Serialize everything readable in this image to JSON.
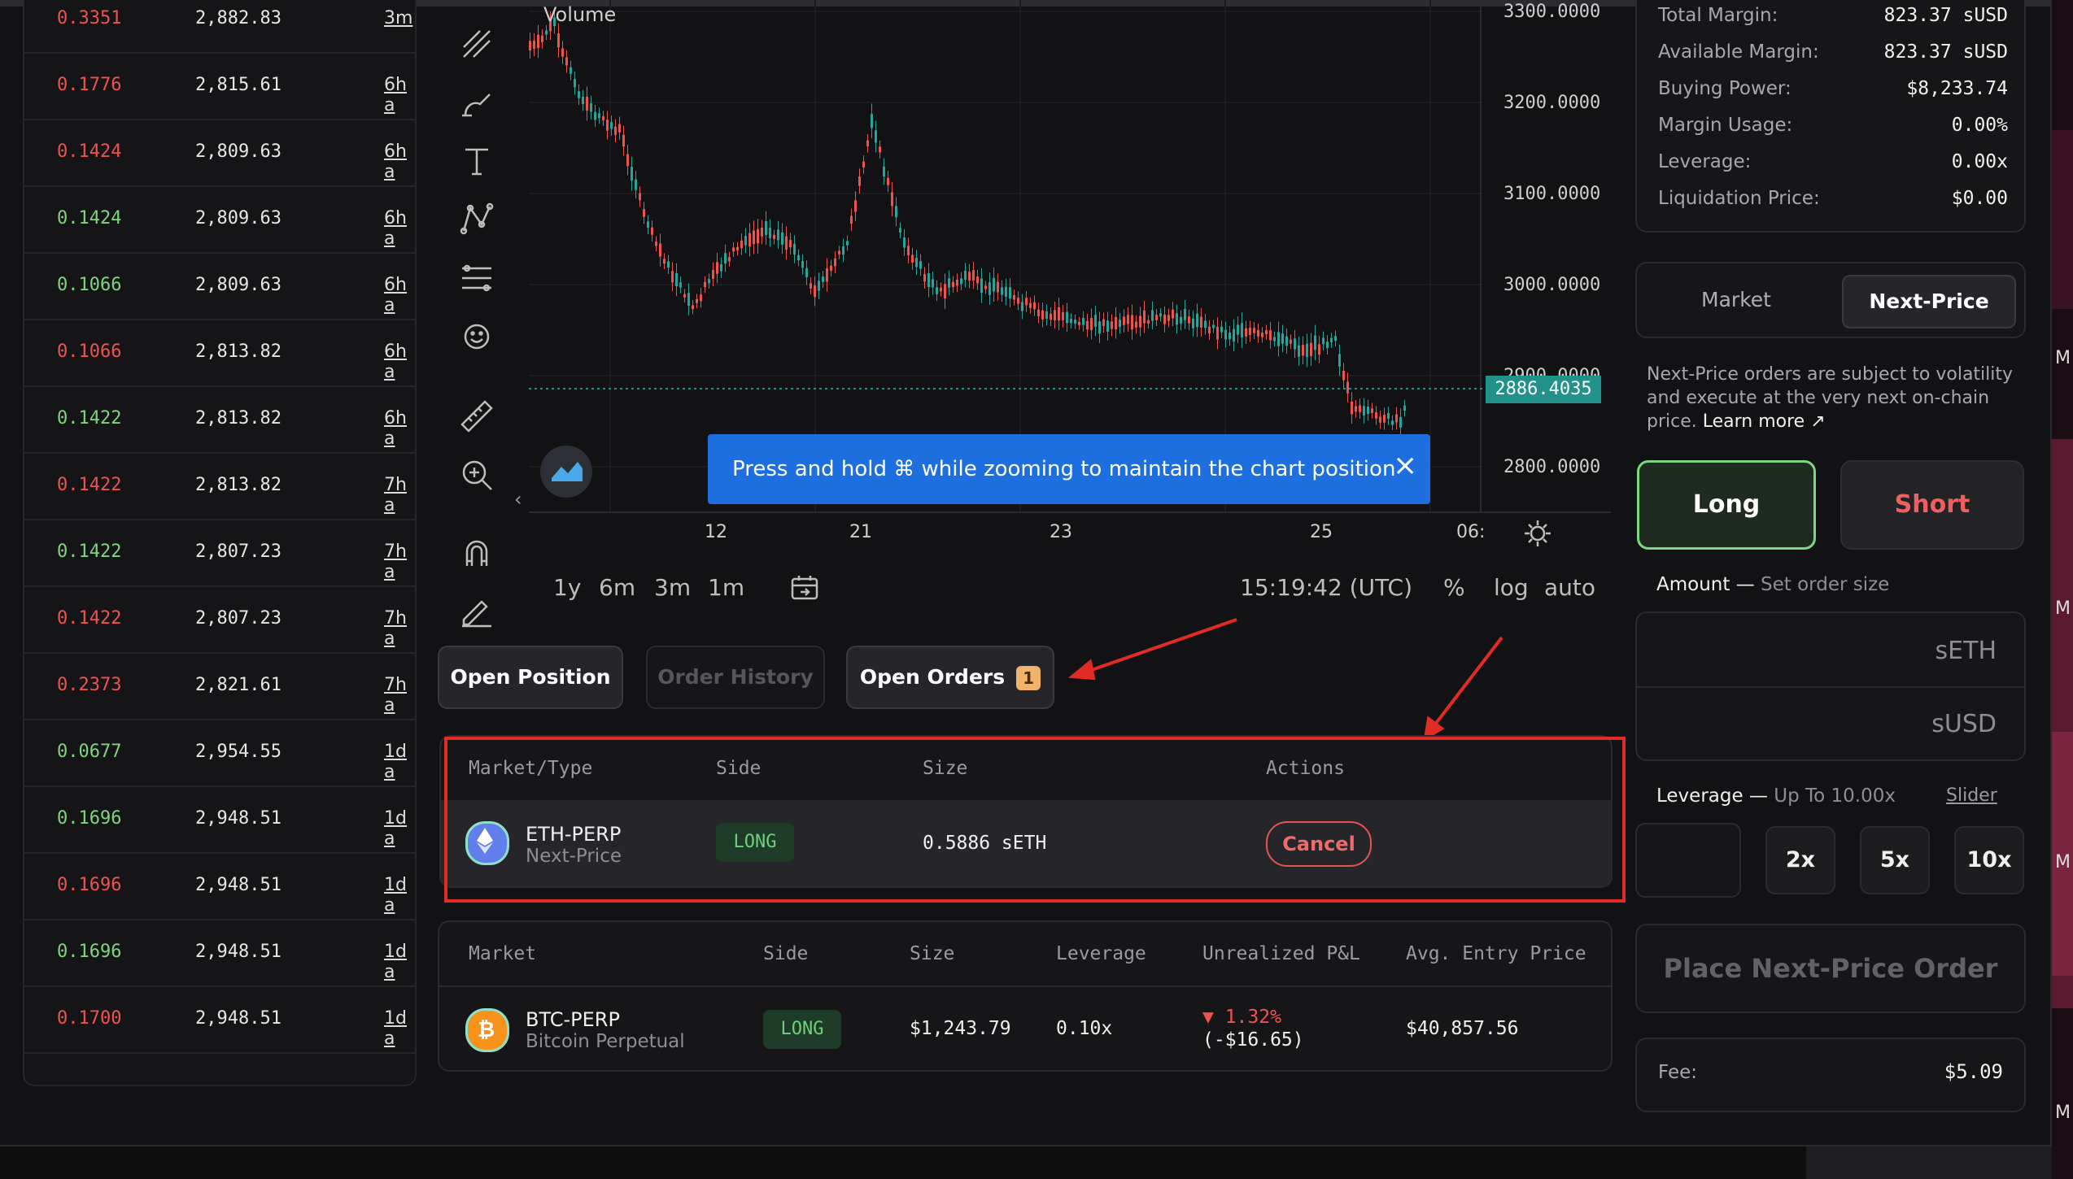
{
  "trades": [
    {
      "price": "0.3351",
      "amount": "2,882.83",
      "time": "3m",
      "color": "red"
    },
    {
      "price": "0.1776",
      "amount": "2,815.61",
      "time": "6h a",
      "color": "red"
    },
    {
      "price": "0.1424",
      "amount": "2,809.63",
      "time": "6h a",
      "color": "red"
    },
    {
      "price": "0.1424",
      "amount": "2,809.63",
      "time": "6h a",
      "color": "green"
    },
    {
      "price": "0.1066",
      "amount": "2,809.63",
      "time": "6h a",
      "color": "green"
    },
    {
      "price": "0.1066",
      "amount": "2,813.82",
      "time": "6h a",
      "color": "red"
    },
    {
      "price": "0.1422",
      "amount": "2,813.82",
      "time": "6h a",
      "color": "green"
    },
    {
      "price": "0.1422",
      "amount": "2,813.82",
      "time": "7h a",
      "color": "red"
    },
    {
      "price": "0.1422",
      "amount": "2,807.23",
      "time": "7h a",
      "color": "green"
    },
    {
      "price": "0.1422",
      "amount": "2,807.23",
      "time": "7h a",
      "color": "red"
    },
    {
      "price": "0.2373",
      "amount": "2,821.61",
      "time": "7h a",
      "color": "red"
    },
    {
      "price": "0.0677",
      "amount": "2,954.55",
      "time": "1d a",
      "color": "green"
    },
    {
      "price": "0.1696",
      "amount": "2,948.51",
      "time": "1d a",
      "color": "green"
    },
    {
      "price": "0.1696",
      "amount": "2,948.51",
      "time": "1d a",
      "color": "red"
    },
    {
      "price": "0.1696",
      "amount": "2,948.51",
      "time": "1d a",
      "color": "green"
    },
    {
      "price": "0.1700",
      "amount": "2,948.51",
      "time": "1d a",
      "color": "red"
    }
  ],
  "chart": {
    "volume_label": "Volume",
    "y_ticks": [
      "3300.0000",
      "3200.0000",
      "3100.0000",
      "3000.0000",
      "2900.0000",
      "2800.0000"
    ],
    "x_ticks": [
      "12",
      "21",
      "23",
      "25",
      "06:"
    ],
    "last_price": "2886.4035",
    "nav_arrow": "‹",
    "toast": {
      "message": "Press and hold ⌘ while zooming to maintain the chart position",
      "close": "×"
    },
    "timeframes": [
      "1y",
      "6m",
      "3m",
      "1m"
    ],
    "clock": "15:19:42 (UTC)",
    "scale_options": [
      "%",
      "log",
      "auto"
    ]
  },
  "tabs": {
    "open_position": "Open Position",
    "order_history": "Order History",
    "open_orders": "Open Orders",
    "open_orders_count": "1"
  },
  "orders": {
    "headers": [
      "Market/Type",
      "Side",
      "Size",
      "Actions"
    ],
    "row": {
      "market": "ETH-PERP",
      "type": "Next-Price",
      "side": "LONG",
      "size": "0.5886 sETH",
      "action": "Cancel"
    }
  },
  "positions": {
    "headers": [
      "Market",
      "Side",
      "Size",
      "Leverage",
      "Unrealized P&L",
      "Avg. Entry Price"
    ],
    "row": {
      "market": "BTC-PERP",
      "subtitle": "Bitcoin Perpetual",
      "side": "LONG",
      "size": "$1,243.79",
      "leverage": "0.10x",
      "pnl_pct": "▼ 1.32%",
      "pnl_usd": "(-$16.65)",
      "entry": "$40,857.56"
    }
  },
  "summary": [
    {
      "label": "Total Margin:",
      "value": "823.37 sUSD"
    },
    {
      "label": "Available Margin:",
      "value": "823.37 sUSD"
    },
    {
      "label": "Buying Power:",
      "value": "$8,233.74"
    },
    {
      "label": "Margin Usage:",
      "value": "0.00%"
    },
    {
      "label": "Leverage:",
      "value": "0.00x"
    },
    {
      "label": "Liquidation Price:",
      "value": "$0.00"
    }
  ],
  "order_type": {
    "market": "Market",
    "next_price": "Next-Price"
  },
  "note": {
    "text": "Next-Price orders are subject to volatility and execute at the very next on-chain price.",
    "link": "Learn more ↗"
  },
  "trade": {
    "long": "Long",
    "short": "Short",
    "amount_label": "Amount",
    "amount_sub": "Set order size",
    "seth_placeholder": "sETH",
    "susd_placeholder": "sUSD",
    "leverage_label": "Leverage",
    "leverage_sub": "Up To 10.00x",
    "slider_link": "Slider",
    "leverage_options": [
      "2x",
      "5x",
      "10x"
    ],
    "place": "Place Next-Price Order",
    "fee_label": "Fee:",
    "fee_value": "$5.09"
  },
  "desktop_glyphs": [
    "M",
    "M",
    "M",
    "M"
  ],
  "colors": {
    "accent_teal": "#21918a",
    "toast_blue": "#1d6fe0",
    "long_green": "#7ed67e",
    "short_red": "#ef5f5f",
    "annotation_red": "#e32b26"
  }
}
